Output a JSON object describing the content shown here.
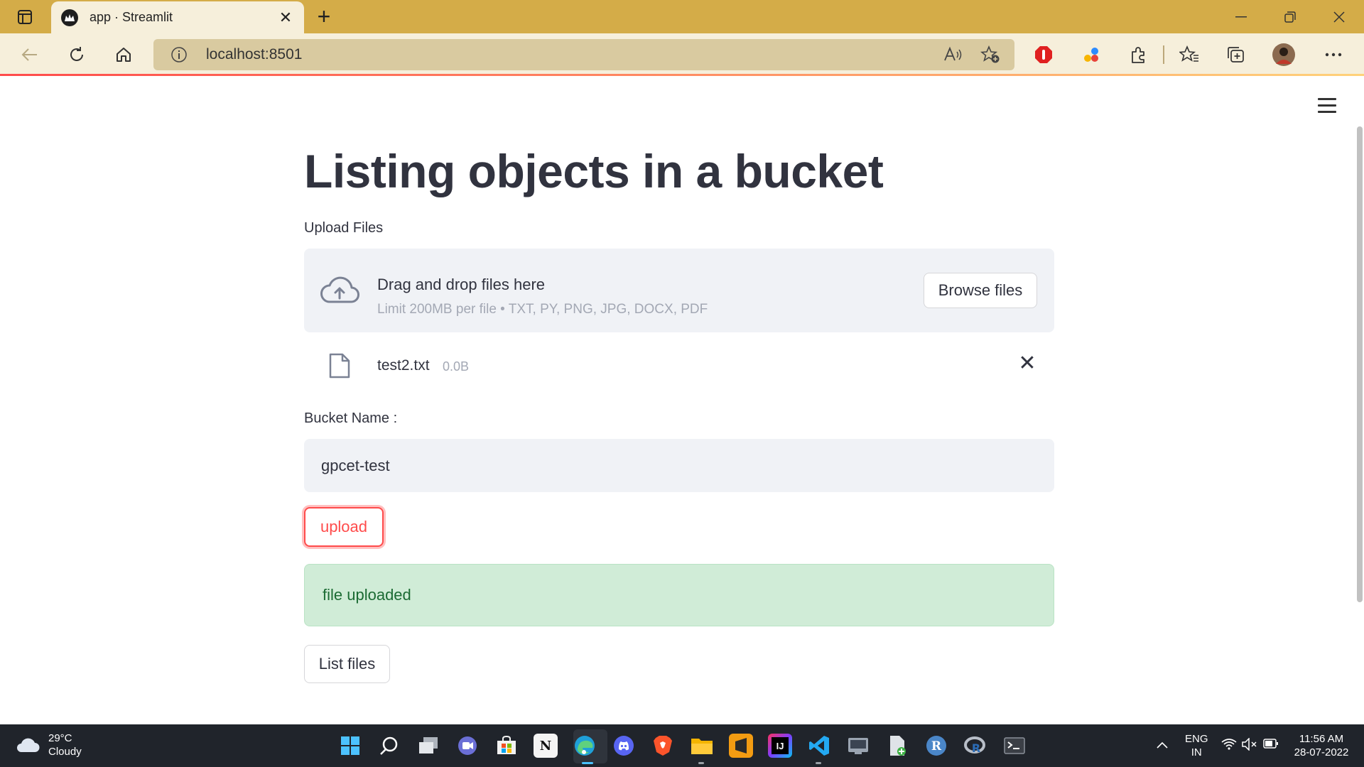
{
  "browser": {
    "tab_title": "app · Streamlit",
    "tab_close": "✕",
    "new_tab": "+",
    "url": "localhost:8501"
  },
  "app": {
    "title": "Listing objects in a bucket",
    "upload_label": "Upload Files",
    "dropzone_title": "Drag and drop files here",
    "dropzone_limit": "Limit 200MB per file • TXT, PY, PNG, JPG, DOCX, PDF",
    "browse_label": "Browse files",
    "file": {
      "name": "test2.txt",
      "size": "0.0B",
      "remove": "✕"
    },
    "bucket_label": "Bucket Name :",
    "bucket_value": "gpcet-test",
    "upload_button": "upload",
    "success_message": "file uploaded",
    "list_button": "List files"
  },
  "colors": {
    "accent": "#ff4b4b",
    "success_bg": "#d0ecd7",
    "success_text": "#1b6b33",
    "tabbar": "#d4ac48"
  },
  "taskbar": {
    "temperature": "29°C",
    "condition": "Cloudy",
    "lang": "ENG",
    "region": "IN",
    "time": "11:56 AM",
    "date": "28-07-2022",
    "apps": [
      "start-icon",
      "search-icon",
      "task-view-icon",
      "chat-icon",
      "store-icon",
      "notion-icon",
      "edge-icon",
      "discord-icon",
      "brave-icon",
      "file-explorer-icon",
      "sublime-icon",
      "intellij-icon",
      "vscode-icon",
      "sql-icon",
      "file-icon",
      "r-icon",
      "rstudio-icon",
      "terminal-icon"
    ]
  }
}
